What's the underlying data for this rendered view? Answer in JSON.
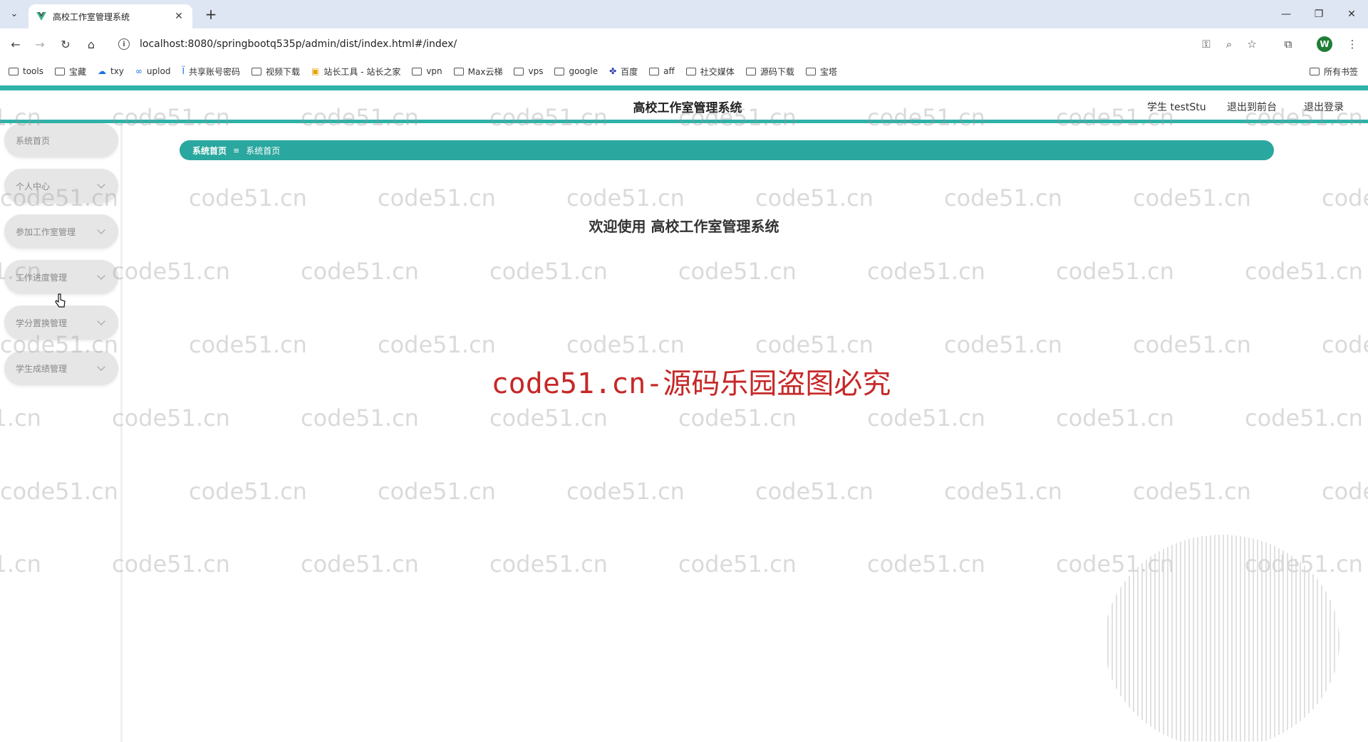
{
  "browser": {
    "tab_title": "高校工作室管理系统",
    "url": "localhost:8080/springbootq535p/admin/dist/index.html#/index/",
    "profile_initial": "W",
    "bookmarks": [
      "tools",
      "宝藏",
      "txy",
      "uplod",
      "共享账号密码",
      "视频下载",
      "站长工具 - 站长之家",
      "vpn",
      "Max云梯",
      "vps",
      "google",
      "百度",
      "aff",
      "社交媒体",
      "源码下载",
      "宝塔"
    ],
    "all_bookmarks": "所有书签"
  },
  "header": {
    "title": "高校工作室管理系统",
    "user": "学生 testStu",
    "back_to_front": "退出到前台",
    "logout": "退出登录"
  },
  "sidebar": {
    "items": [
      {
        "label": "系统首页",
        "expandable": false
      },
      {
        "label": "个人中心",
        "expandable": true
      },
      {
        "label": "参加工作室管理",
        "expandable": true
      },
      {
        "label": "工作进度管理",
        "expandable": true
      },
      {
        "label": "学分置换管理",
        "expandable": true
      },
      {
        "label": "学生成绩管理",
        "expandable": true
      }
    ]
  },
  "breadcrumb": {
    "root": "系统首页",
    "separator": "≡",
    "current": "系统首页"
  },
  "main": {
    "welcome": "欢迎使用 高校工作室管理系统"
  },
  "watermark": {
    "text": "code51.cn",
    "notice": "code51.cn-源码乐园盗图必究"
  },
  "colors": {
    "accent": "#2fb2a8",
    "breadcrumb": "#2aa79e",
    "notice": "#c62828"
  }
}
